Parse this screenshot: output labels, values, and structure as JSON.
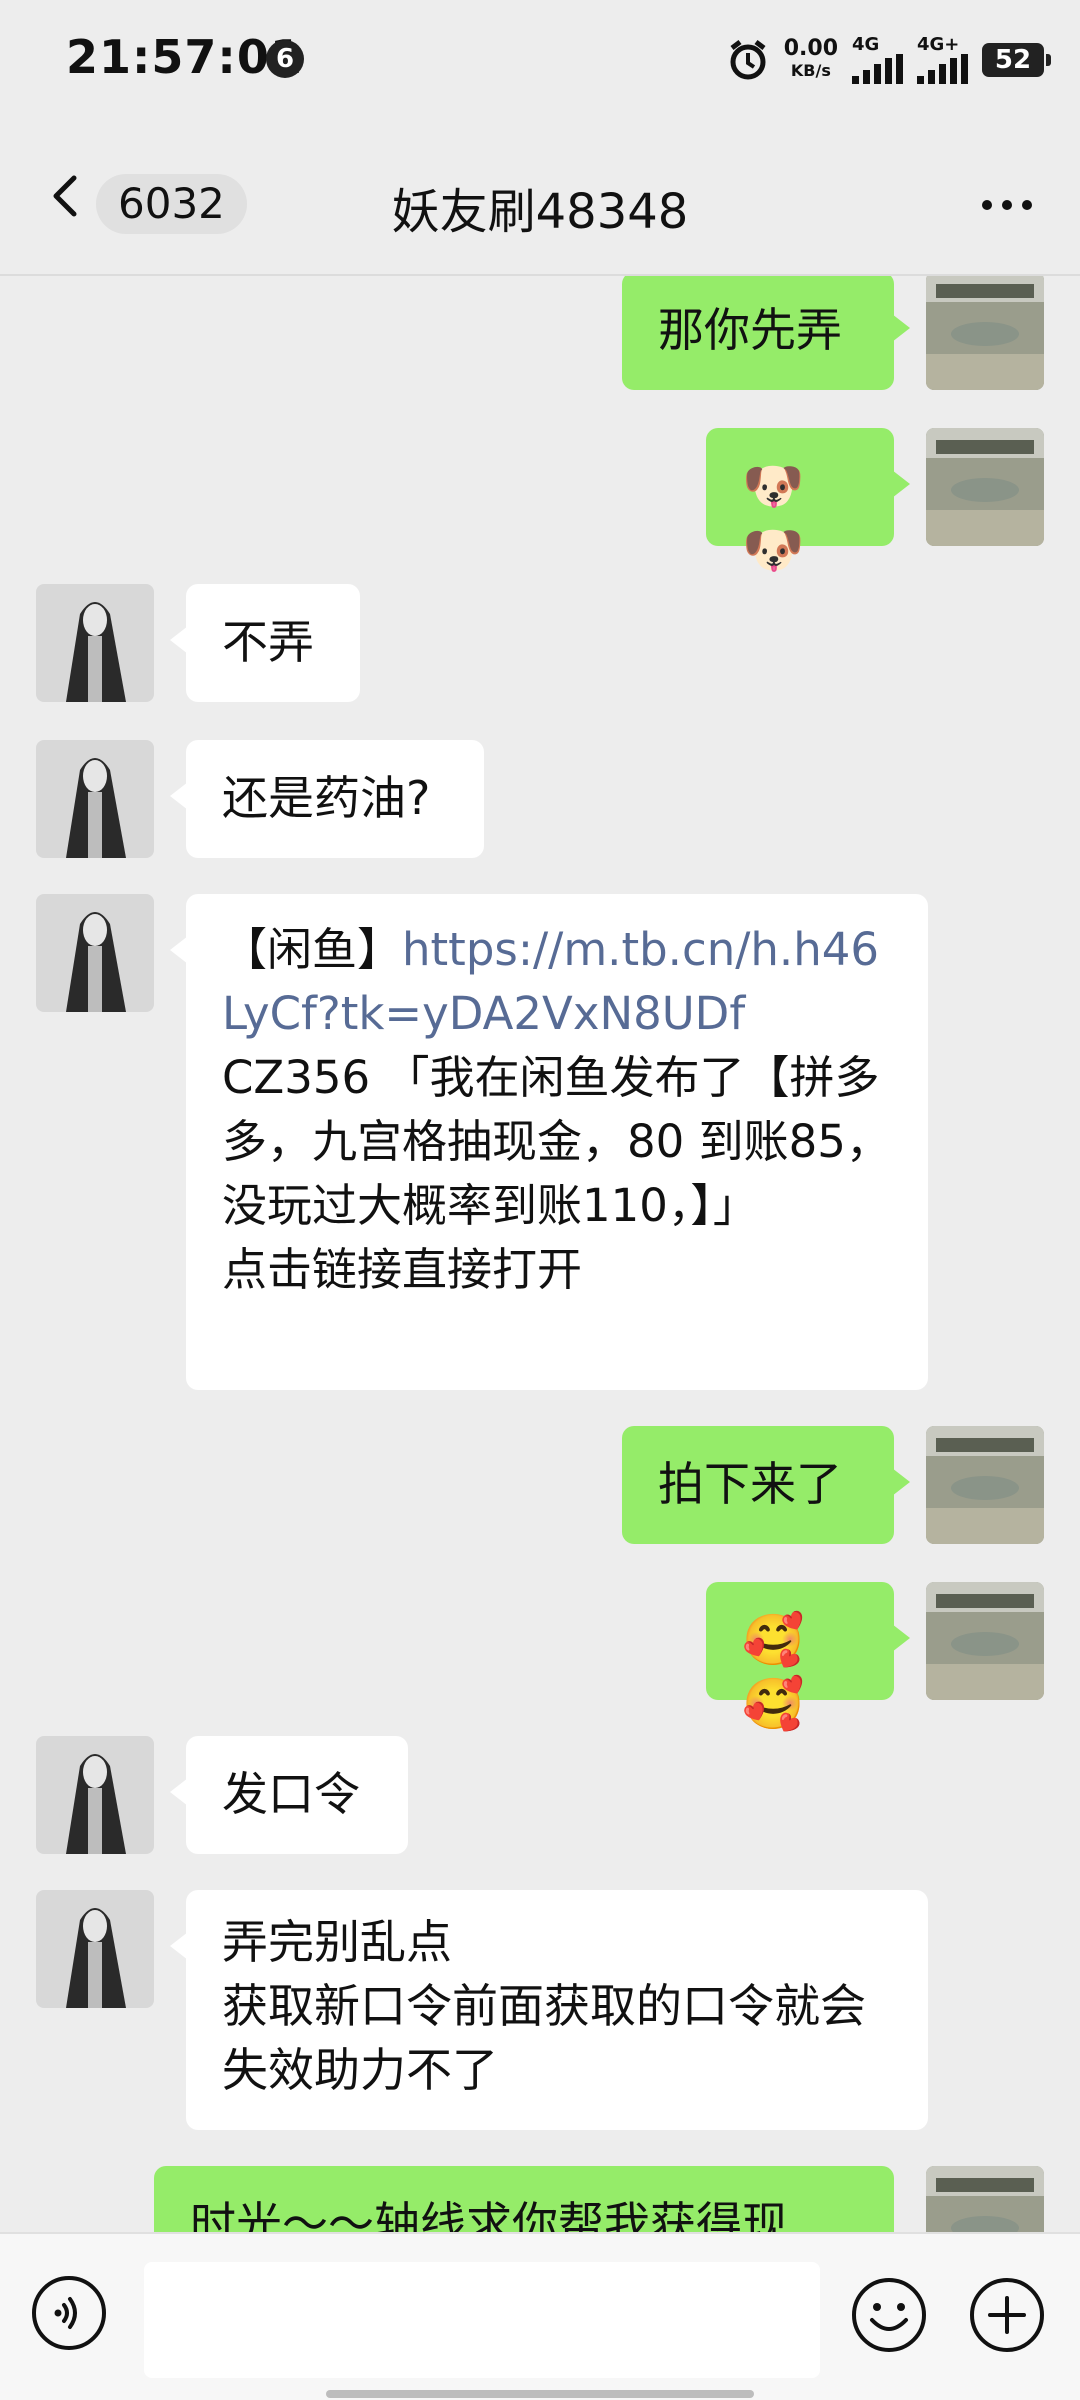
{
  "status_bar": {
    "time": "21:57:01",
    "notification_count": "6",
    "net_speed": "0.00",
    "net_speed_unit": "KB/s",
    "sim1_label": "4G",
    "sim2_label": "4G+",
    "battery": "52"
  },
  "header": {
    "unread_count": "6032",
    "title": "妖友刷48348"
  },
  "messages": [
    {
      "from": "me",
      "text": "那你先弄"
    },
    {
      "from": "me",
      "text": "🐶🐶"
    },
    {
      "from": "them",
      "text": "不弄"
    },
    {
      "from": "them",
      "text": "还是药油?"
    },
    {
      "from": "them",
      "prefix": "【闲鱼】",
      "link": "https://m.tb.cn/h.h46LyCf?tk=yDA2VxN8UDf",
      "text": "CZ356 「我在闲鱼发布了【拼多多，九宫格抽现金，80 到账85，没玩过大概率到账110，】」\n点击链接直接打开"
    },
    {
      "from": "me",
      "text": "拍下来了"
    },
    {
      "from": "me",
      "text": "🥰🥰"
    },
    {
      "from": "them",
      "text": "发口令"
    },
    {
      "from": "them",
      "text": "弄完别乱点\n获取新口令前面获取的口令就会失效助力不了"
    },
    {
      "from": "me",
      "text": "时光～～轴线求你帮我获得现"
    }
  ],
  "input": {
    "placeholder": ""
  },
  "icons": {
    "back": "chevron-left-icon",
    "more": "more-dots-icon",
    "voice": "voice-icon",
    "emoji": "smiley-icon",
    "plus": "plus-icon"
  }
}
